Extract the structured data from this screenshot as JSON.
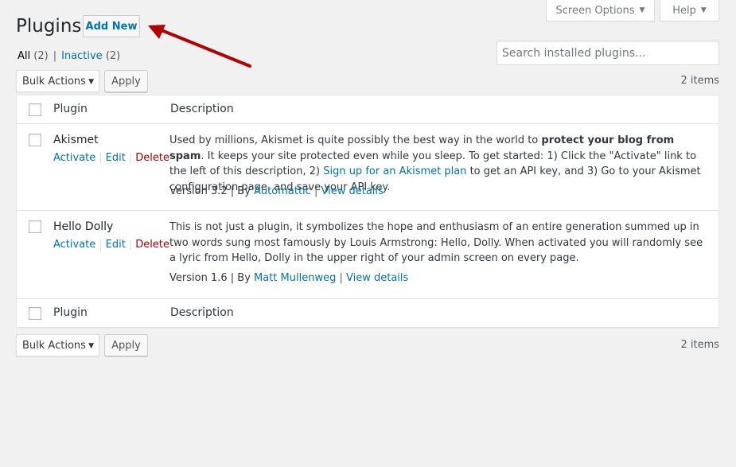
{
  "header": {
    "screen_options_label": "Screen Options",
    "help_label": "Help",
    "title": "Plugins",
    "add_new_label": "Add New"
  },
  "filters": {
    "all_label": "All",
    "all_count": "(2)",
    "separator": "|",
    "inactive_label": "Inactive",
    "inactive_count": "(2)"
  },
  "search": {
    "placeholder": "Search installed plugins..."
  },
  "tablenav": {
    "bulk_actions_label": "Bulk Actions",
    "apply_label": "Apply",
    "items_count": "2 items"
  },
  "table": {
    "columns": {
      "plugin": "Plugin",
      "description": "Description"
    },
    "rows": [
      {
        "name": "Akismet",
        "actions": {
          "activate": "Activate",
          "edit": "Edit",
          "delete": "Delete",
          "sep": "|"
        },
        "desc_part1": "Used by millions, Akismet is quite possibly the best way in the world to ",
        "desc_bold": "protect your blog from spam",
        "desc_part2": ". It keeps your site protected even while you sleep. To get started: 1) Click the \"Activate\" link to the left of this description, 2) ",
        "desc_link": "Sign up for an Akismet plan",
        "desc_part3": " to get an API key, and 3) Go to your Akismet configuration page, and save your API key.",
        "version": "Version 3.2",
        "by": "| By",
        "author": "Automattic",
        "details": "View details"
      },
      {
        "name": "Hello Dolly",
        "actions": {
          "activate": "Activate",
          "edit": "Edit",
          "delete": "Delete",
          "sep": "|"
        },
        "desc_part1": "This is not just a plugin, it symbolizes the hope and enthusiasm of an entire generation summed up in two words sung most famously by Louis Armstrong: Hello, Dolly. When activated you will randomly see a lyric from Hello, Dolly in the upper right of your admin screen on every page.",
        "version": "Version 1.6",
        "by": "| By",
        "author": "Matt Mullenweg",
        "details": "View details"
      }
    ]
  },
  "colors": {
    "link": "#0073aa",
    "delete": "#aa0000",
    "background": "#f1f1f1",
    "arrow": "#b30000"
  }
}
